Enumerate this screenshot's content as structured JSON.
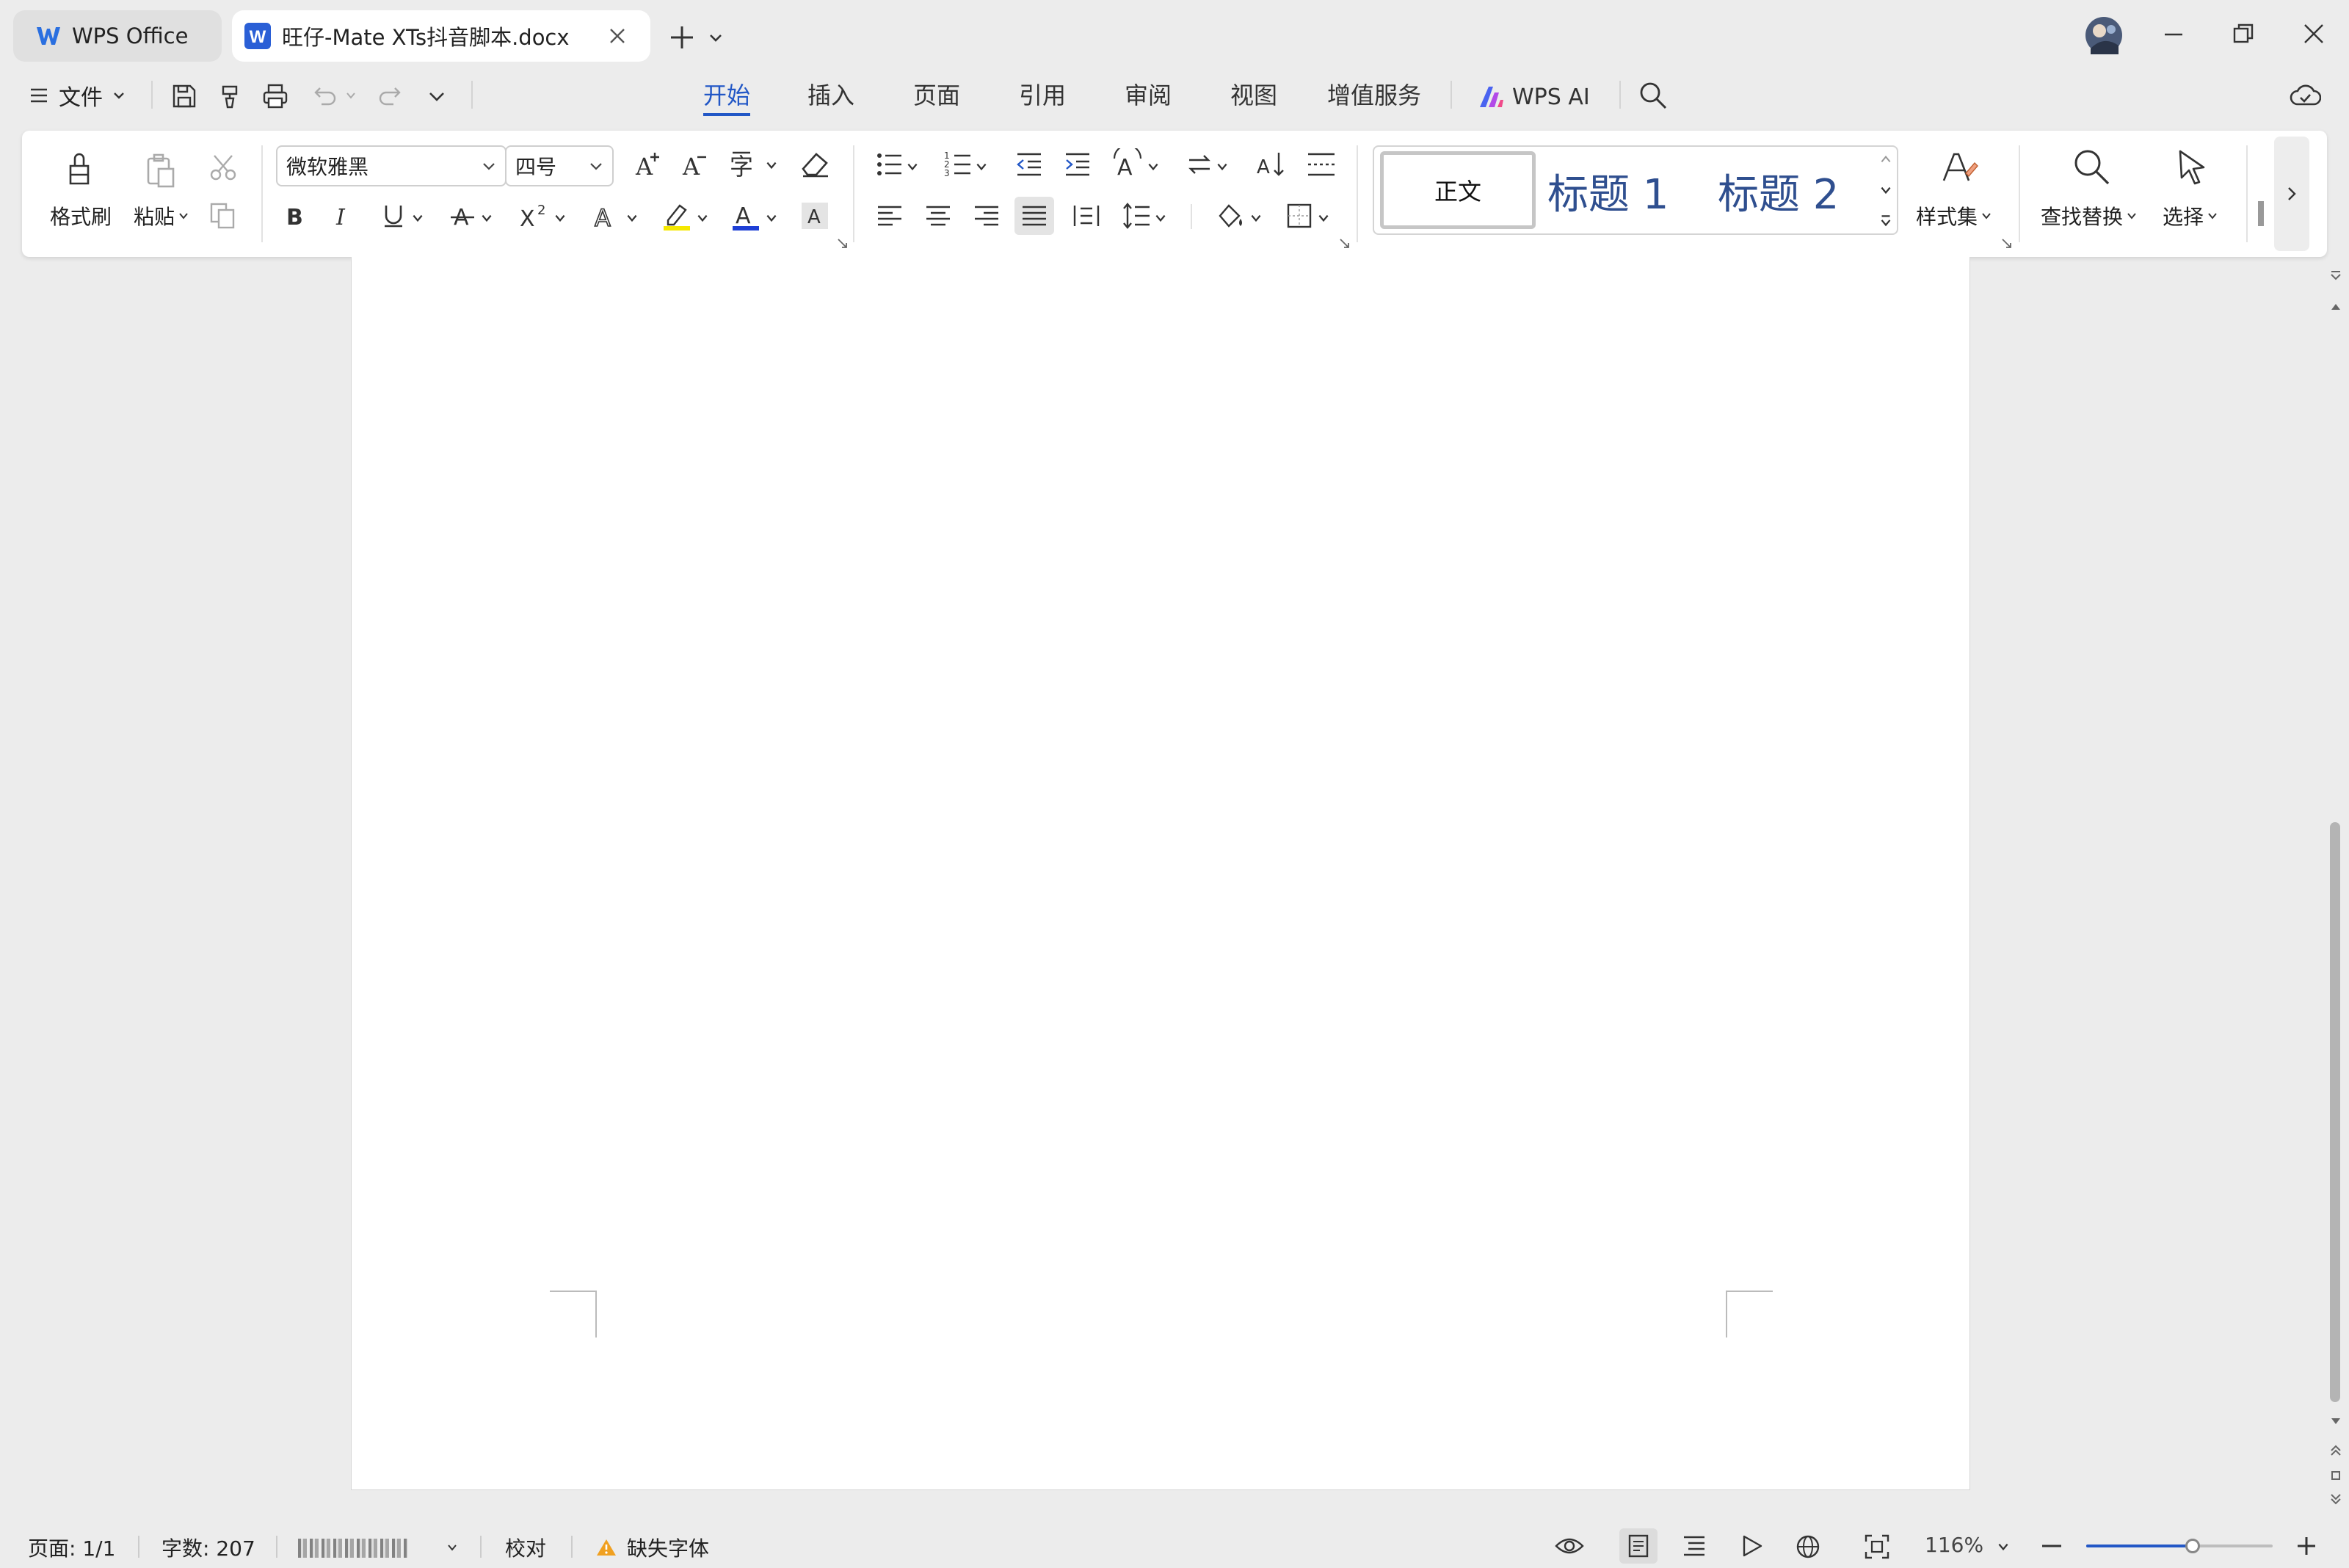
{
  "tabs": {
    "home_label": "WPS Office",
    "doc_label": "旺仔-Mate XTs抖音脚本.docx"
  },
  "menu": {
    "file_label": "文件"
  },
  "ribbon_tabs": [
    "开始",
    "插入",
    "页面",
    "引用",
    "审阅",
    "视图",
    "增值服务"
  ],
  "wps_ai_label": "WPS AI",
  "ribbon": {
    "format_painter": "格式刷",
    "paste": "粘贴",
    "font_name": "微软雅黑",
    "font_size": "四号",
    "style_normal": "正文",
    "style_h1": "标题 1",
    "style_h2": "标题 2",
    "style_set": "样式集",
    "find_replace": "查找替换",
    "select": "选择"
  },
  "status": {
    "page": "页面: 1/1",
    "word_count": "字数: 207",
    "proofread": "校对",
    "missing_font": "缺失字体",
    "zoom": "116%",
    "zoom_fraction": 0.57
  },
  "colors": {
    "accent": "#2257c6",
    "highlight": "#f5e800",
    "font_color": "#1e3fd6",
    "heading_blue": "#2f4f8f",
    "warning": "#f0a020"
  }
}
